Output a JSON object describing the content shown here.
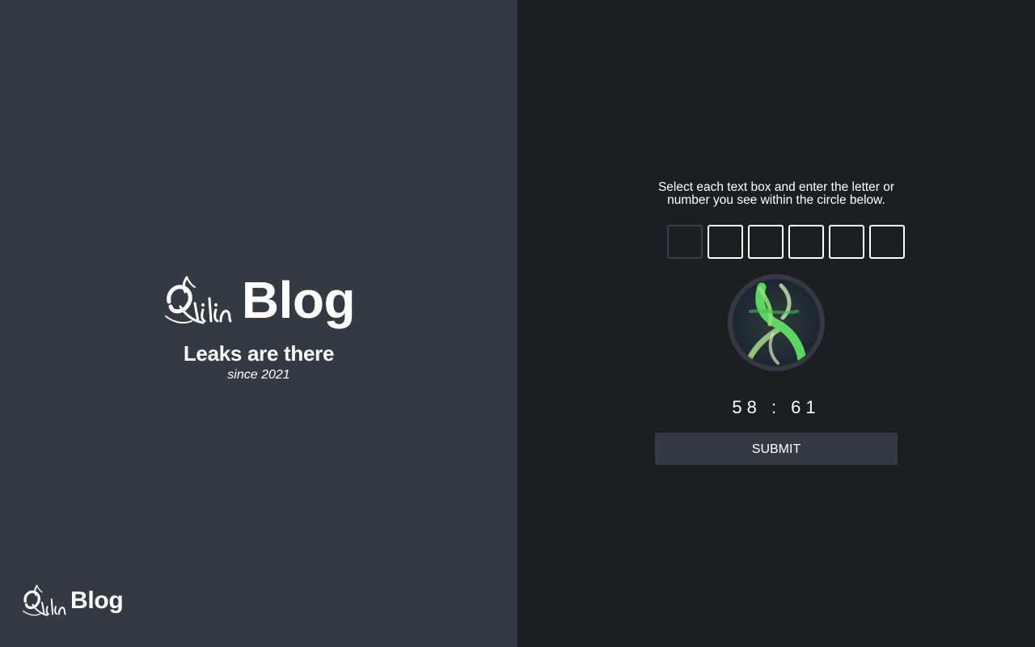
{
  "brand": {
    "title": "Blog",
    "logo_icon": "qilin-logo-icon",
    "tagline": "Leaks are there",
    "since": "since 2021"
  },
  "footer": {
    "title": "Blog",
    "logo_icon": "qilin-logo-icon"
  },
  "captcha": {
    "instructions": "Select each text box and enter the letter or number you see within the circle below.",
    "input_count": 6,
    "inputs": [
      "",
      "",
      "",
      "",
      "",
      ""
    ],
    "active_input": 0,
    "image_icon": "captcha-image",
    "timer": "58 : 61",
    "submit_label": "SUBMIT"
  },
  "colors": {
    "left_panel": "#353941",
    "right_panel": "#1c1e22",
    "text": "#ffffff",
    "captcha_glyph": "#5bd65e"
  }
}
